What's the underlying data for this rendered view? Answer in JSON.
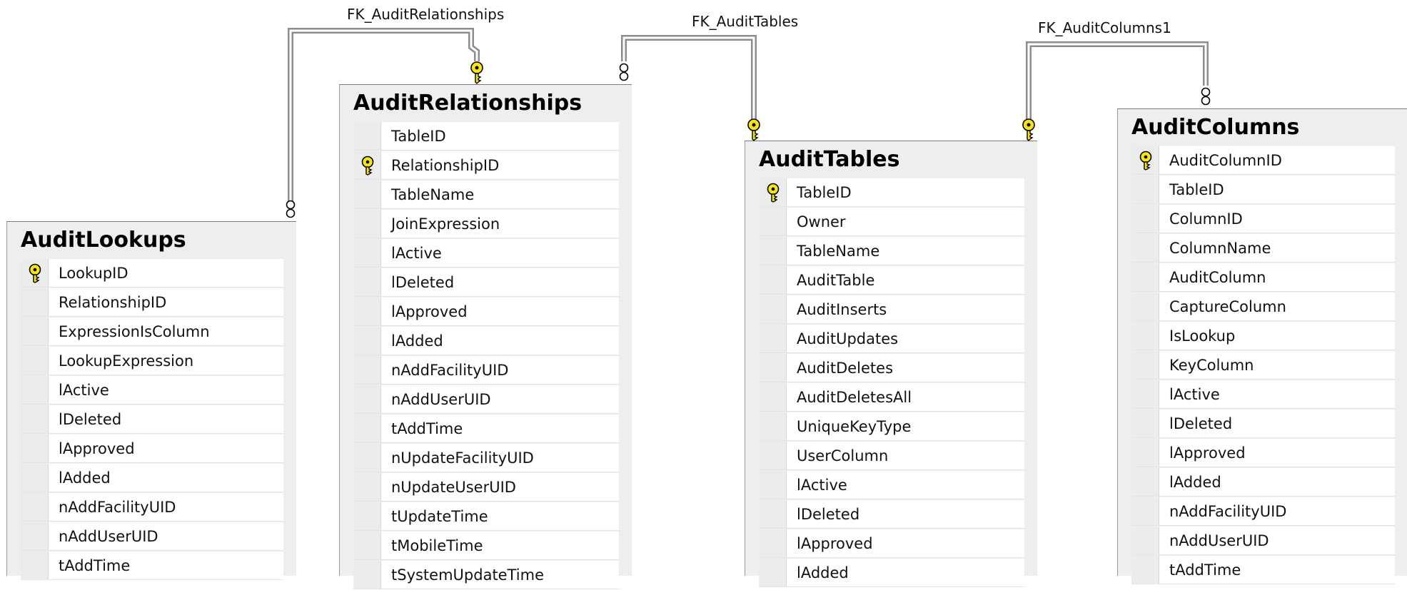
{
  "relationships": [
    {
      "name": "FK_AuditRelationships"
    },
    {
      "name": "FK_AuditTables"
    },
    {
      "name": "FK_AuditColumns1"
    }
  ],
  "tables": {
    "auditlookups": {
      "title": "AuditLookups",
      "columns": [
        {
          "name": "LookupID",
          "pk": true
        },
        {
          "name": "RelationshipID"
        },
        {
          "name": "ExpressionIsColumn"
        },
        {
          "name": "LookupExpression"
        },
        {
          "name": "lActive"
        },
        {
          "name": "lDeleted"
        },
        {
          "name": "lApproved"
        },
        {
          "name": "lAdded"
        },
        {
          "name": "nAddFacilityUID"
        },
        {
          "name": "nAddUserUID"
        },
        {
          "name": "tAddTime"
        }
      ]
    },
    "auditrelationships": {
      "title": "AuditRelationships",
      "columns": [
        {
          "name": "TableID"
        },
        {
          "name": "RelationshipID",
          "pk": true
        },
        {
          "name": "TableName"
        },
        {
          "name": "JoinExpression"
        },
        {
          "name": "lActive"
        },
        {
          "name": "lDeleted"
        },
        {
          "name": "lApproved"
        },
        {
          "name": "lAdded"
        },
        {
          "name": "nAddFacilityUID"
        },
        {
          "name": "nAddUserUID"
        },
        {
          "name": "tAddTime"
        },
        {
          "name": "nUpdateFacilityUID"
        },
        {
          "name": "nUpdateUserUID"
        },
        {
          "name": "tUpdateTime"
        },
        {
          "name": "tMobileTime"
        },
        {
          "name": "tSystemUpdateTime"
        }
      ]
    },
    "audittables": {
      "title": "AuditTables",
      "columns": [
        {
          "name": "TableID",
          "pk": true
        },
        {
          "name": "Owner"
        },
        {
          "name": "TableName"
        },
        {
          "name": "AuditTable"
        },
        {
          "name": "AuditInserts"
        },
        {
          "name": "AuditUpdates"
        },
        {
          "name": "AuditDeletes"
        },
        {
          "name": "AuditDeletesAll"
        },
        {
          "name": "UniqueKeyType"
        },
        {
          "name": "UserColumn"
        },
        {
          "name": "lActive"
        },
        {
          "name": "lDeleted"
        },
        {
          "name": "lApproved"
        },
        {
          "name": "lAdded"
        }
      ]
    },
    "auditcolumns": {
      "title": "AuditColumns",
      "columns": [
        {
          "name": "AuditColumnID",
          "pk": true
        },
        {
          "name": "TableID"
        },
        {
          "name": "ColumnID"
        },
        {
          "name": "ColumnName"
        },
        {
          "name": "AuditColumn"
        },
        {
          "name": "CaptureColumn"
        },
        {
          "name": "IsLookup"
        },
        {
          "name": "KeyColumn"
        },
        {
          "name": "lActive"
        },
        {
          "name": "lDeleted"
        },
        {
          "name": "lApproved"
        },
        {
          "name": "lAdded"
        },
        {
          "name": "nAddFacilityUID"
        },
        {
          "name": "nAddUserUID"
        },
        {
          "name": "tAddTime"
        }
      ]
    }
  },
  "colors": {
    "key_fill": "#f7e418",
    "key_stroke": "#000000",
    "connector_line": "#8c8c8c",
    "table_bg": "#eeeeee"
  }
}
